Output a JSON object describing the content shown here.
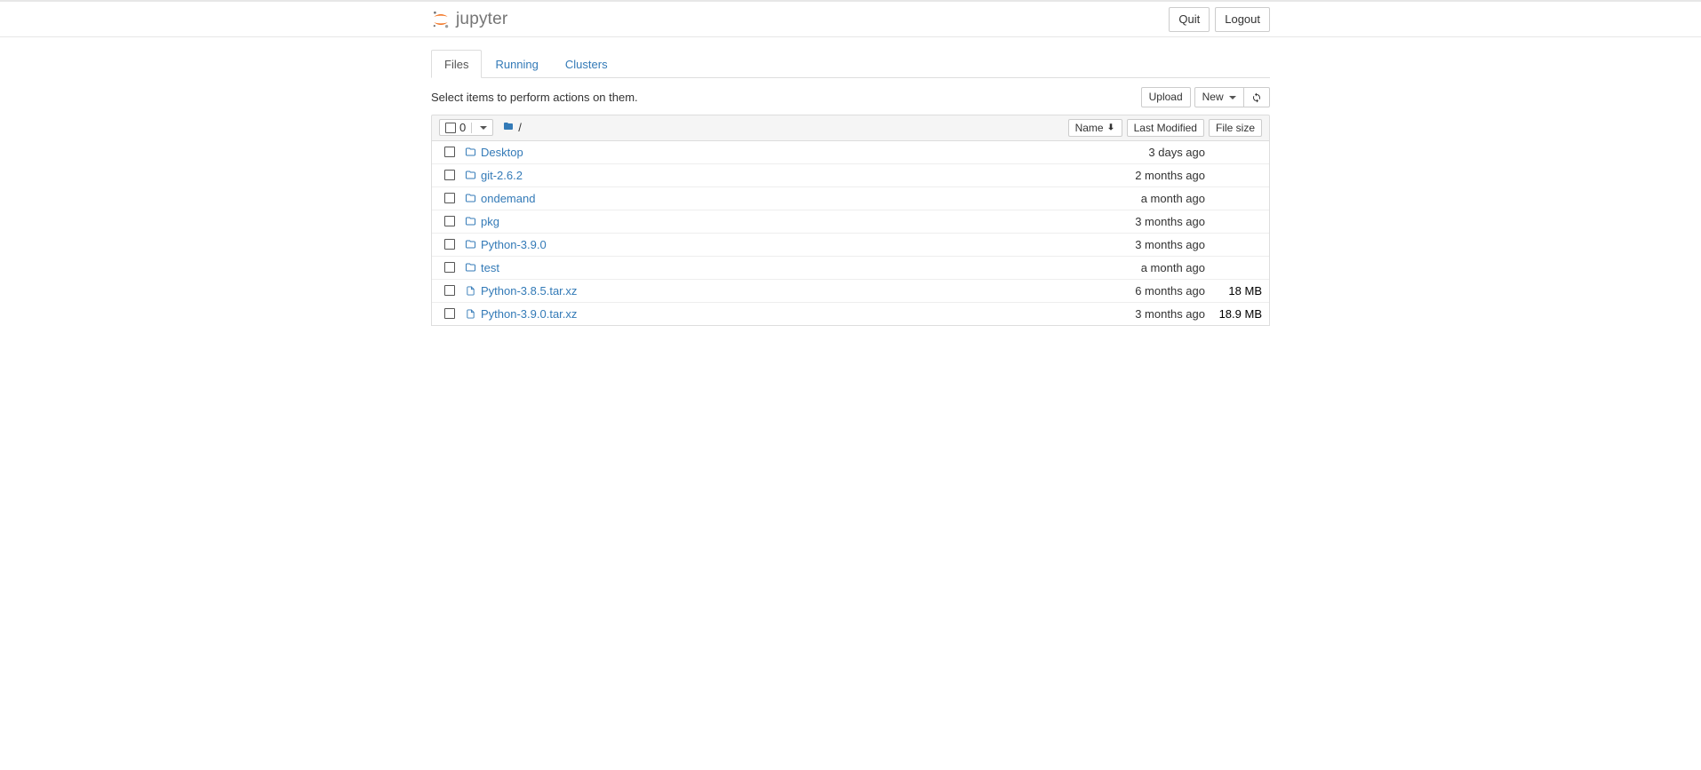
{
  "header": {
    "logo_text": "jupyter",
    "quit_label": "Quit",
    "logout_label": "Logout"
  },
  "tabs": {
    "files": "Files",
    "running": "Running",
    "clusters": "Clusters"
  },
  "actions": {
    "prompt": "Select items to perform actions on them.",
    "upload_label": "Upload",
    "new_label": "New"
  },
  "list_header": {
    "selected_count": "0",
    "breadcrumb_sep": "/",
    "col_name": "Name",
    "col_modified": "Last Modified",
    "col_size": "File size"
  },
  "items": [
    {
      "type": "folder",
      "name": "Desktop",
      "modified": "3 days ago",
      "size": ""
    },
    {
      "type": "folder",
      "name": "git-2.6.2",
      "modified": "2 months ago",
      "size": ""
    },
    {
      "type": "folder",
      "name": "ondemand",
      "modified": "a month ago",
      "size": ""
    },
    {
      "type": "folder",
      "name": "pkg",
      "modified": "3 months ago",
      "size": ""
    },
    {
      "type": "folder",
      "name": "Python-3.9.0",
      "modified": "3 months ago",
      "size": ""
    },
    {
      "type": "folder",
      "name": "test",
      "modified": "a month ago",
      "size": ""
    },
    {
      "type": "file",
      "name": "Python-3.8.5.tar.xz",
      "modified": "6 months ago",
      "size": "18 MB"
    },
    {
      "type": "file",
      "name": "Python-3.9.0.tar.xz",
      "modified": "3 months ago",
      "size": "18.9 MB"
    }
  ]
}
